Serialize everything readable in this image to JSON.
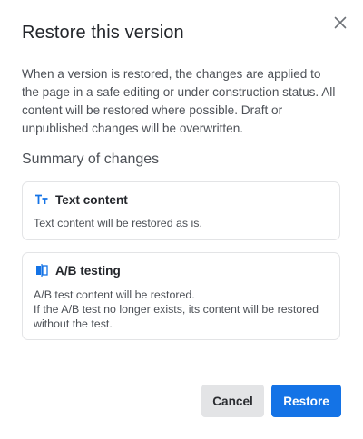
{
  "dialog": {
    "title": "Restore this version",
    "description": "When a version is restored, the changes are applied to the page in a safe editing or under construction status. All content will be restored where possible. Draft or unpublished changes will be overwritten.",
    "close_icon": "close-icon"
  },
  "summary": {
    "heading": "Summary of changes",
    "cards": [
      {
        "icon": "text-type-icon",
        "title": "Text content",
        "body": "Text content will be restored as is."
      },
      {
        "icon": "ab-testing-icon",
        "title": "A/B testing",
        "body_line1": "A/B test content will be restored.",
        "body_line2": "If the A/B test no longer exists, its content will be restored without the test."
      }
    ]
  },
  "footer": {
    "cancel_label": "Cancel",
    "restore_label": "Restore"
  },
  "colors": {
    "accent": "#1473e6",
    "secondary_button": "#e3e4e6",
    "border": "#e3e4e6"
  }
}
